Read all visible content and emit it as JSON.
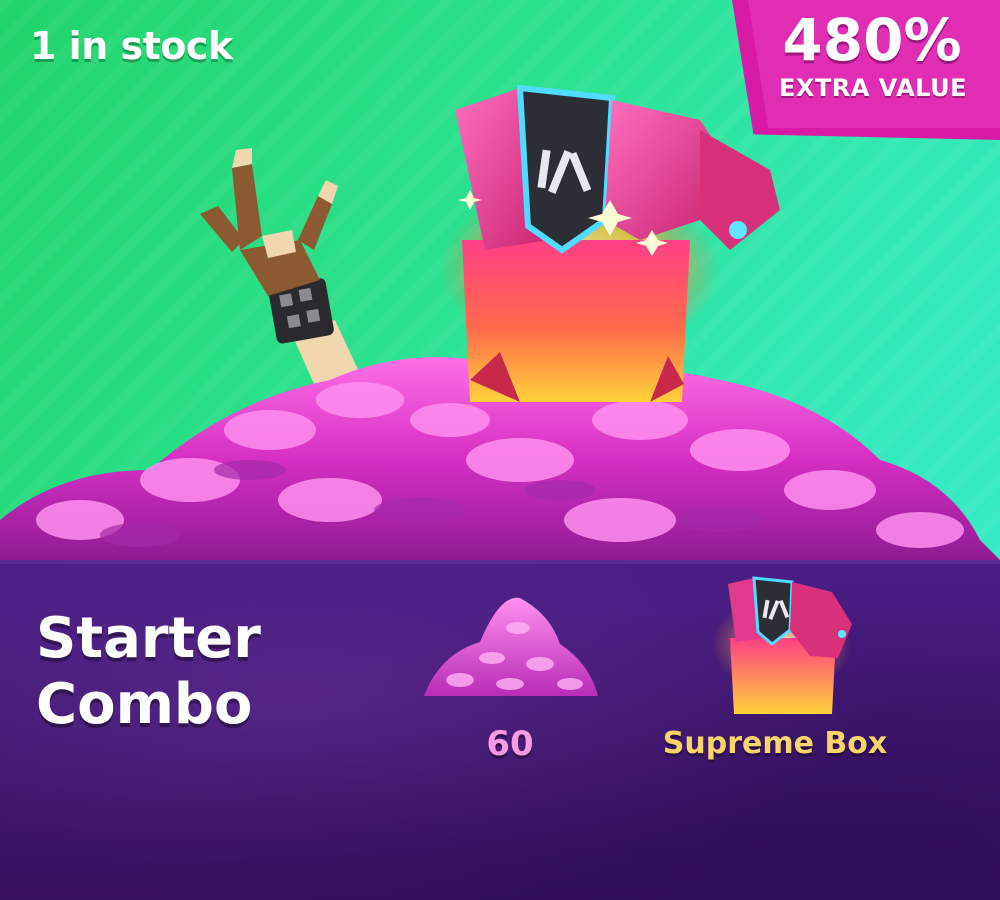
{
  "offer": {
    "stock_text": "1 in stock",
    "badge": {
      "value": "480%",
      "label": "EXTRA VALUE"
    },
    "title_line1": "Starter",
    "title_line2": "Combo",
    "items": [
      {
        "icon": "gem-pile-icon",
        "label": "60"
      },
      {
        "icon": "supreme-box-icon",
        "label": "Supreme Box"
      }
    ]
  },
  "colors": {
    "hero_green": "#22d46a",
    "hero_teal": "#36eac6",
    "badge_pink": "#e02db4",
    "panel_purple": "#4a1e86",
    "gem_pink": "#f59ae3",
    "box_gold": "#f8d56b"
  }
}
